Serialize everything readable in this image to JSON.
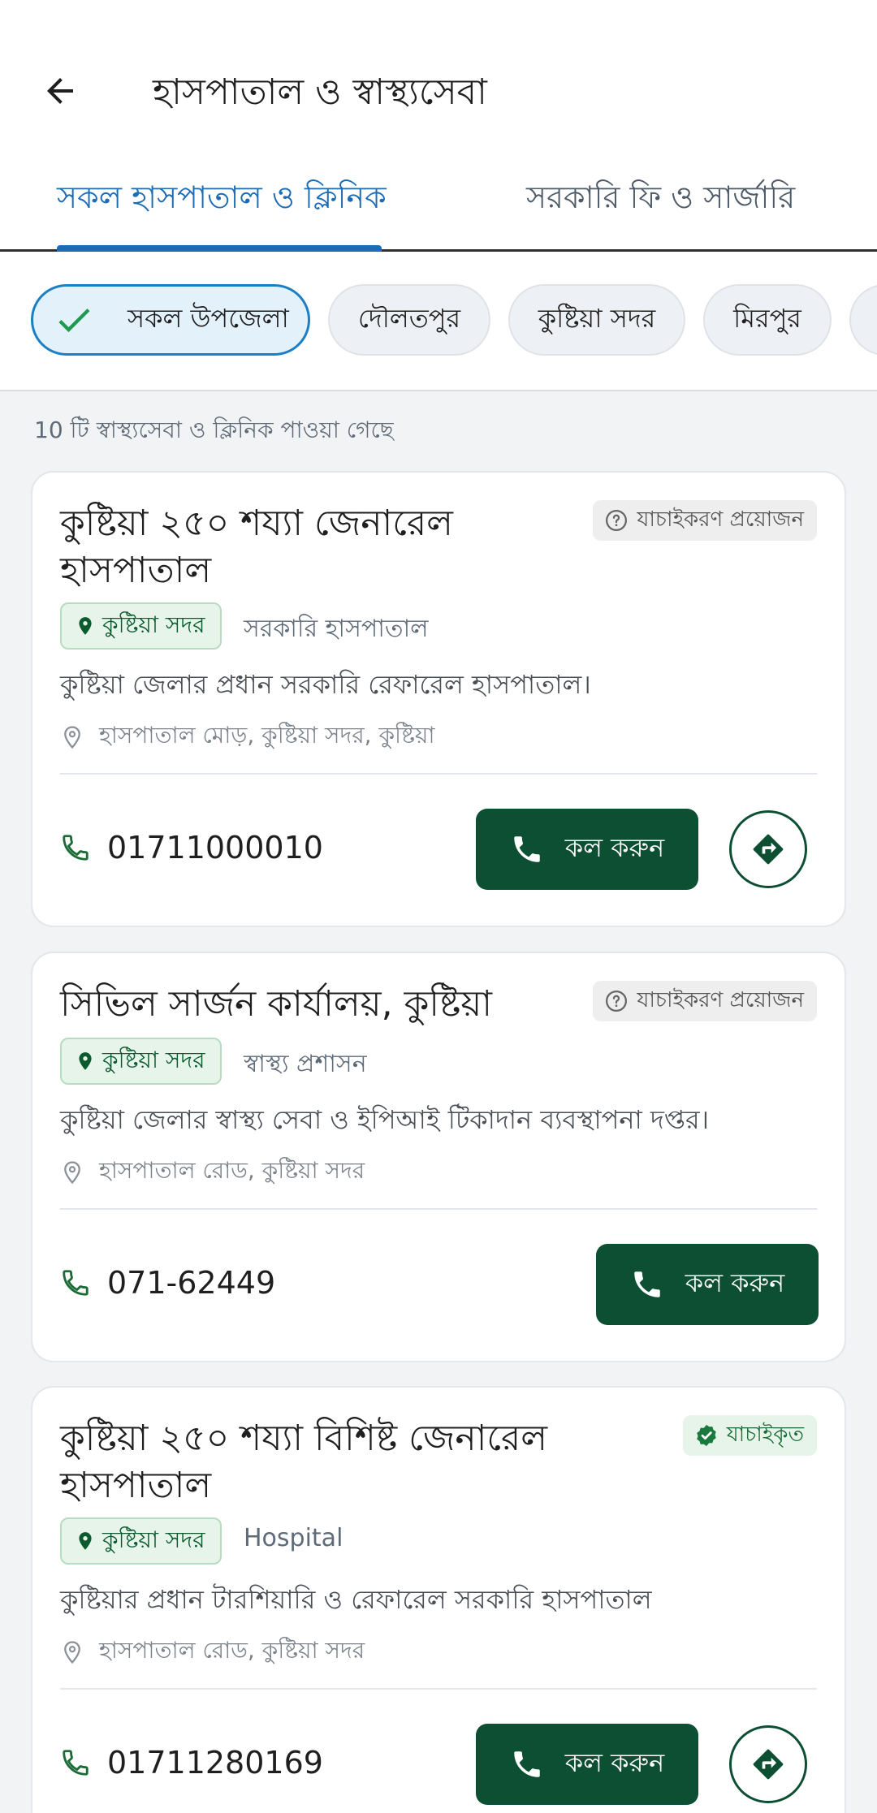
{
  "header": {
    "title": "হাসপাতাল ও স্বাস্থ্যসেবা"
  },
  "tabs": [
    {
      "label": "সকল হাসপাতাল ও ক্লিনিক",
      "active": true
    },
    {
      "label": "সরকারি ফি ও সার্জারি",
      "active": false
    }
  ],
  "filters": [
    {
      "label": "সকল উপজেলা",
      "selected": true
    },
    {
      "label": "দৌলতপুর",
      "selected": false
    },
    {
      "label": "কুষ্টিয়া সদর",
      "selected": false
    },
    {
      "label": "মিরপুর",
      "selected": false
    }
  ],
  "result_count": "10 টি স্বাস্থ্যসেবা ও ক্লিনিক পাওয়া গেছে",
  "call_label": "কল করুন",
  "cards": [
    {
      "title": "কুষ্টিয়া ২৫০ শয্যা জেনারেল হাসপাতাল",
      "badge": "যাচাইকরণ প্রয়োজন",
      "verified": false,
      "location": "কুষ্টিয়া সদর",
      "category": "সরকারি হাসপাতাল",
      "description": "কুষ্টিয়া জেলার প্রধান সরকারি রেফারেল হাসপাতাল।",
      "address": "হাসপাতাল মোড়, কুষ্টিয়া সদর, কুষ্টিয়া",
      "phone": "01711000010",
      "has_directions": true
    },
    {
      "title": "সিভিল সার্জন কার্যালয়, কুষ্টিয়া",
      "badge": "যাচাইকরণ প্রয়োজন",
      "verified": false,
      "location": "কুষ্টিয়া সদর",
      "category": "স্বাস্থ্য প্রশাসন",
      "description": "কুষ্টিয়া জেলার স্বাস্থ্য সেবা ও ইপিআই টিকাদান ব্যবস্থাপনা দপ্তর।",
      "address": "হাসপাতাল রোড, কুষ্টিয়া সদর",
      "phone": "071-62449",
      "has_directions": false
    },
    {
      "title": "কুষ্টিয়া ২৫০ শয্যা বিশিষ্ট জেনারেল হাসপাতাল",
      "badge": "যাচাইকৃত",
      "verified": true,
      "location": "কুষ্টিয়া সদর",
      "category": "Hospital",
      "description": "কুষ্টিয়ার প্রধান টারশিয়ারি ও রেফারেল সরকারি হাসপাতাল",
      "address": "হাসপাতাল রোড, কুষ্টিয়া সদর",
      "phone": "01711280169",
      "has_directions": true
    }
  ],
  "colors": {
    "primary_blue": "#1c6bb5",
    "dark_green": "#0d4f32",
    "light_green": "#e6f4ea"
  }
}
